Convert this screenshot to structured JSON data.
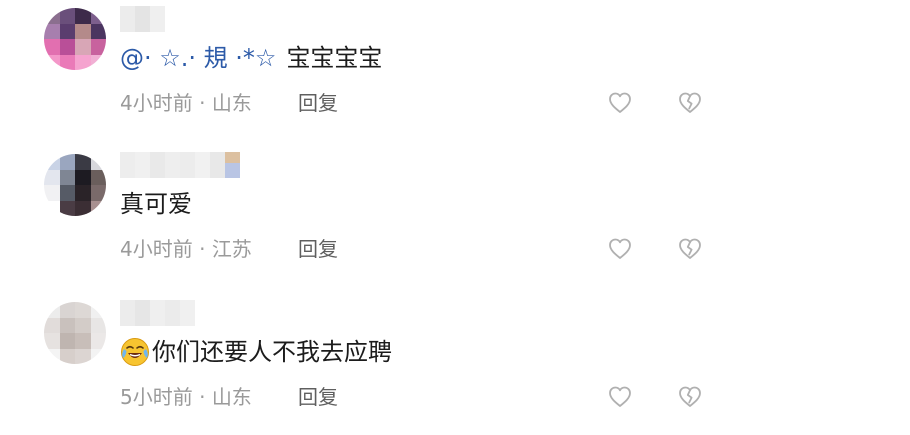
{
  "comments": [
    {
      "mention": "@· ☆.· 規 ·*☆",
      "text": "宝宝宝宝",
      "time": "4小时前",
      "location": "山东",
      "reply_label": "回复",
      "like_icon": "heart-outline-icon",
      "dislike_icon": "broken-heart-icon"
    },
    {
      "text": "真可爱",
      "time": "4小时前",
      "location": "江苏",
      "reply_label": "回复",
      "like_icon": "heart-outline-icon",
      "dislike_icon": "broken-heart-icon"
    },
    {
      "emoji": "crying-laughing-emoji",
      "text": "你们还要人不我去应聘",
      "time": "5小时前",
      "location": "山东",
      "reply_label": "回复",
      "like_icon": "heart-outline-icon",
      "dislike_icon": "broken-heart-icon"
    }
  ],
  "meta_separator": " · ",
  "colors": {
    "mention": "#2c5aa8",
    "text": "#1c1c1c",
    "meta": "#9a9a9a",
    "reply": "#5f5f5f",
    "icon": "#b0b0b0"
  }
}
